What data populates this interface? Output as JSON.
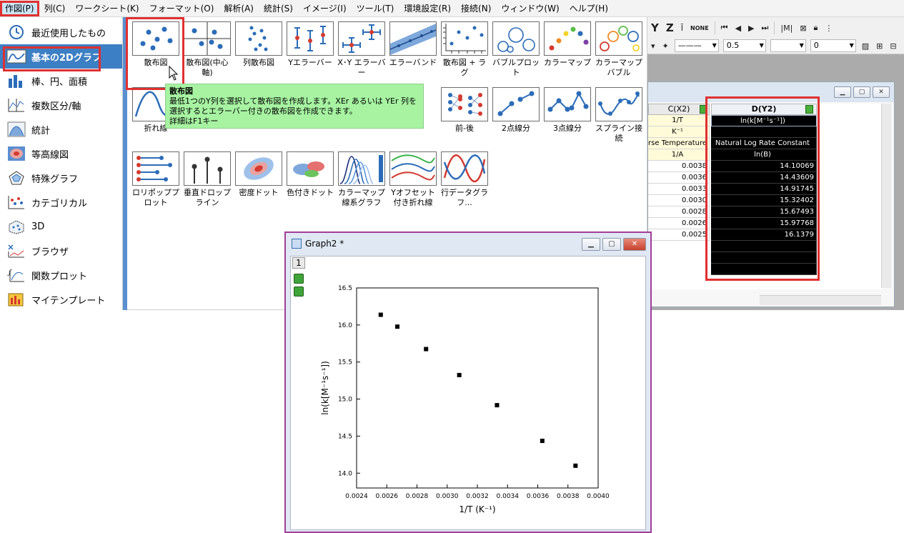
{
  "menubar": {
    "items": [
      "作図(P)",
      "列(C)",
      "ワークシート(K)",
      "フォーマット(O)",
      "解析(A)",
      "統計(S)",
      "イメージ(I)",
      "ツール(T)",
      "環境設定(R)",
      "接続(N)",
      "ウィンドウ(W)",
      "ヘルプ(H)"
    ]
  },
  "toolbar": {
    "row1": [
      "Y",
      "Z",
      "NONE"
    ],
    "line_width": "0.5",
    "transparency": "0"
  },
  "categories": [
    {
      "label": "最近使用したもの",
      "icon": "recent-icon"
    },
    {
      "label": "基本の2Dグラフ",
      "icon": "basic-2d-icon"
    },
    {
      "label": "棒、円、面積",
      "icon": "bar-chart-icon"
    },
    {
      "label": "複数区分/軸",
      "icon": "multi-axis-icon"
    },
    {
      "label": "統計",
      "icon": "histogram-icon"
    },
    {
      "label": "等高線図",
      "icon": "contour-icon"
    },
    {
      "label": "特殊グラフ",
      "icon": "special-graph-icon"
    },
    {
      "label": "カテゴリカル",
      "icon": "categorical-icon"
    },
    {
      "label": "3D",
      "icon": "3d-icon"
    },
    {
      "label": "ブラウザ",
      "icon": "browser-icon"
    },
    {
      "label": "関数プロット",
      "icon": "function-plot-icon"
    },
    {
      "label": "マイテンプレート",
      "icon": "template-icon"
    }
  ],
  "gallery": {
    "row1": [
      "散布図",
      "散布図(中心軸)",
      "列散布図",
      "Yエラーバー",
      "X･Y エラーバー",
      "エラーバンド",
      "散布図 + ラグ",
      "バブルプロット",
      "カラーマップ",
      "カラーマップバブル"
    ],
    "row2": [
      "折れ線",
      "",
      "",
      "",
      "",
      "",
      "前-後",
      "2点線分",
      "3点線分",
      "スプライン接続"
    ],
    "row3": [
      "ロリポッププロット",
      "垂直ドロップライン",
      "密度ドット",
      "色付きドット",
      "カラーマップ線系グラフ",
      "Yオフセット付き折れ線",
      "行データグラフ..."
    ]
  },
  "tooltip": {
    "title": "散布図",
    "body": "最低1つのY列を選択して散布図を作成します。XEr あるいは YEr 列を選択するとエラーバー付きの散布図を作成できます。",
    "hint": "詳細はF1キー"
  },
  "worksheet": {
    "col_c_header": "C(X2)",
    "col_d_header": "D(Y2)",
    "col_c_meta": [
      "1/T",
      "K⁻¹",
      "rse Temperature",
      "1/A"
    ],
    "col_d_meta": [
      "ln(k[M⁻¹s⁻¹])",
      "",
      "Natural Log Rate Constant",
      "ln(B)"
    ],
    "col_c_values": [
      "0.0038",
      "0.0036",
      "0.0033",
      "0.0030",
      "0.0028",
      "0.0026",
      "0.0025"
    ],
    "col_d_values": [
      "14.10069",
      "14.43609",
      "14.91745",
      "15.32402",
      "15.67493",
      "15.97768",
      "16.1379"
    ]
  },
  "graph": {
    "title": "Graph2 *",
    "layer_label": "1"
  },
  "chart_data": {
    "type": "scatter",
    "x": [
      0.00385,
      0.00363,
      0.00333,
      0.00308,
      0.00286,
      0.00267,
      0.00256
    ],
    "y": [
      14.10069,
      14.43609,
      14.91745,
      15.32402,
      15.67493,
      15.97768,
      16.1379
    ],
    "xlabel": "1/T (K⁻¹)",
    "ylabel": "ln(k[M⁻¹s⁻¹])",
    "xlim": [
      0.0024,
      0.004
    ],
    "ylim": [
      13.8,
      16.5
    ],
    "xticks": [
      "0.0024",
      "0.0026",
      "0.0028",
      "0.0030",
      "0.0032",
      "0.0034",
      "0.0036",
      "0.0038",
      "0.0040"
    ],
    "yticks": [
      "14.0",
      "14.5",
      "15.0",
      "15.5",
      "16.0",
      "16.5"
    ],
    "marker_color": "#000000"
  }
}
